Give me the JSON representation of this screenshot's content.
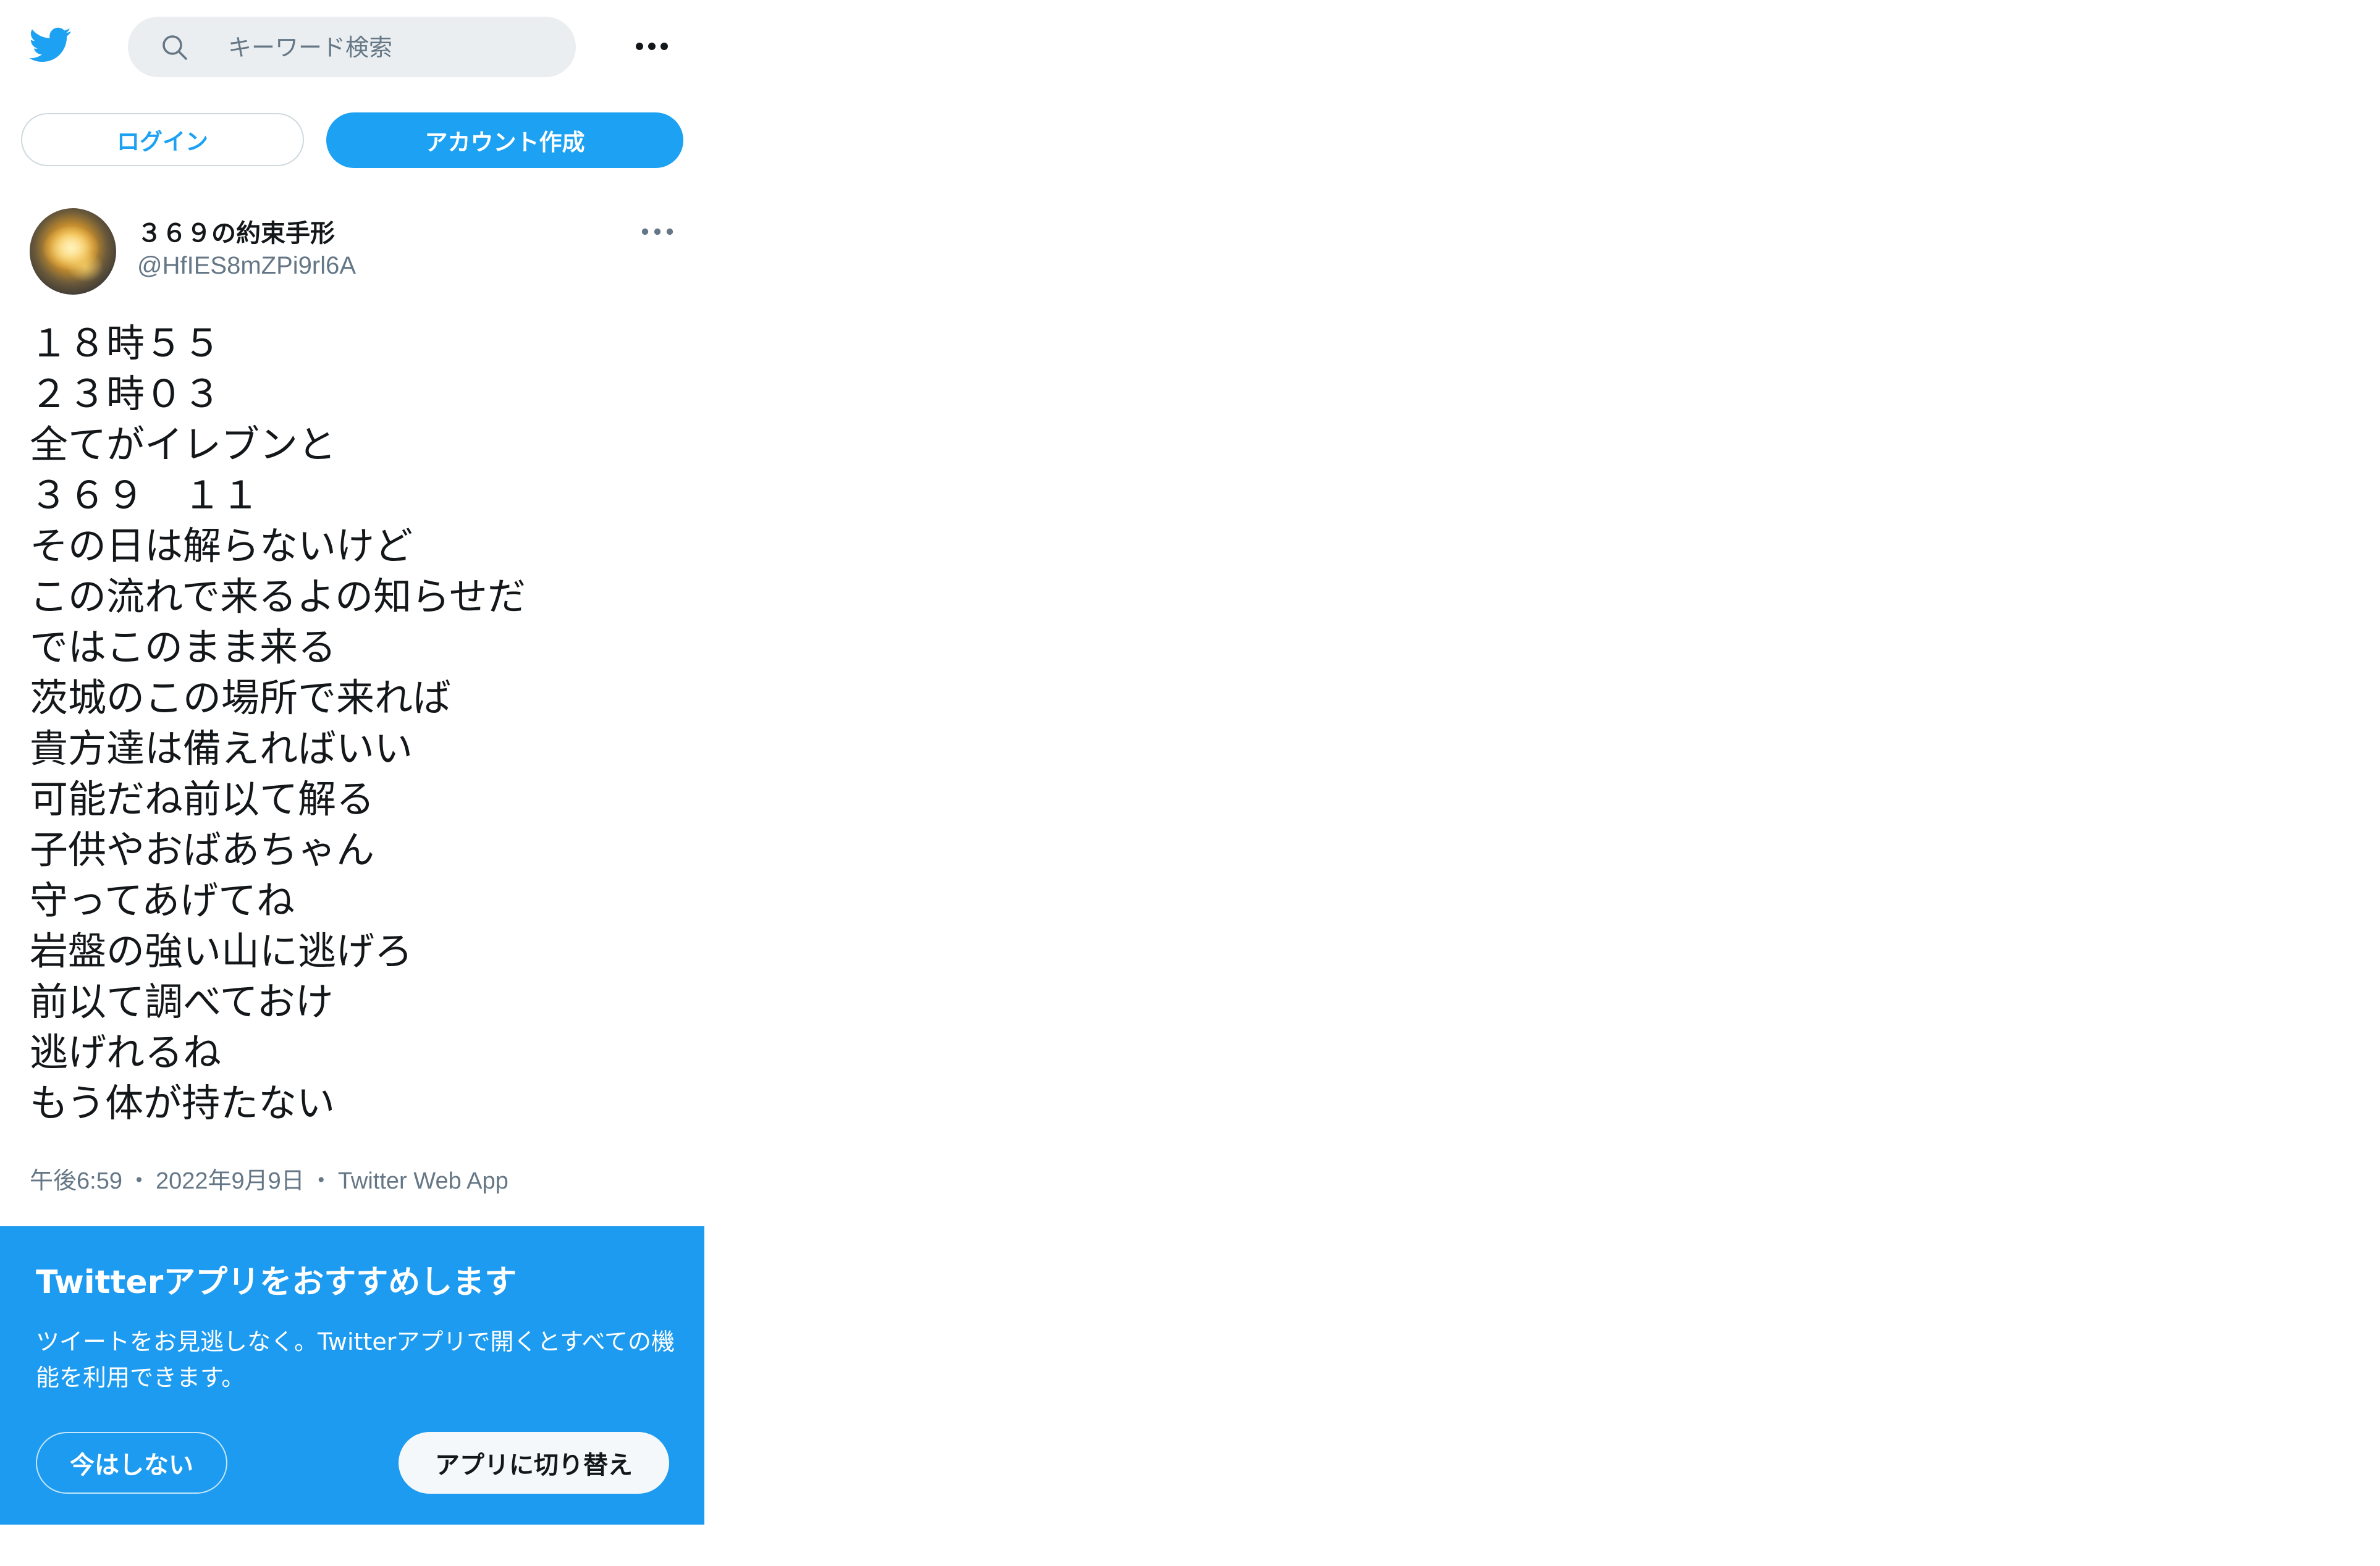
{
  "header": {
    "logo_icon": "twitter-bird-icon",
    "search": {
      "placeholder": "キーワード検索",
      "icon": "search-icon"
    },
    "more_icon": "more-horizontal-icon"
  },
  "auth": {
    "login_label": "ログイン",
    "signup_label": "アカウント作成"
  },
  "tweet": {
    "author": {
      "display_name": "３６９の約束手形",
      "handle": "@HfIES8mZPi9rl6A"
    },
    "lines": [
      "１８時５５",
      "２３時０３",
      "全てがイレブンと",
      "３６９　１１",
      "その日は解らないけど",
      "この流れで来るよの知らせだ",
      "ではこのまま来る",
      "茨城のこの場所で来れば",
      "貴方達は備えればいい",
      "可能だね前以て解る",
      "子供やおばあちゃん",
      "守ってあげてね",
      "岩盤の強い山に逃げろ",
      "前以て調べておけ",
      "逃げれるね",
      "もう体が持たない"
    ],
    "meta": {
      "time": "午後6:59",
      "separator": "・",
      "date": "2022年9月9日",
      "source": "Twitter Web App"
    }
  },
  "promo": {
    "title": "Twitterアプリをおすすめします",
    "description": "ツイートをお見逃しなく。Twitterアプリで開くとすべての機能を利用できます。",
    "not_now_label": "今はしない",
    "switch_label": "アプリに切り替え"
  },
  "colors": {
    "brand": "#1da1f2",
    "promo_bg": "#1d9bf0",
    "text_primary": "#14171a",
    "text_secondary": "#657786",
    "search_bg": "#ebeef0"
  }
}
